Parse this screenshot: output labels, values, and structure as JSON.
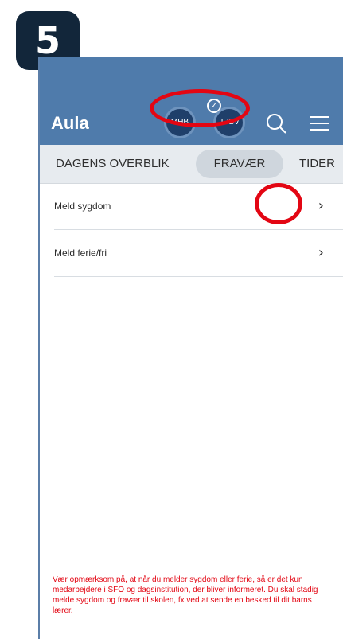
{
  "step": {
    "number": "5"
  },
  "header": {
    "title": "Aula",
    "avatars": [
      {
        "initials": "MHB"
      },
      {
        "initials": "JHBV"
      }
    ],
    "icons": [
      "checkmark-icon",
      "search-icon",
      "menu-icon"
    ]
  },
  "tabs": [
    {
      "label": "DAGENS OVERBLIK"
    },
    {
      "label": "FRAVÆR"
    },
    {
      "label": "TIDER"
    }
  ],
  "list": [
    {
      "label": "Meld sygdom",
      "chevron": "›"
    },
    {
      "label": "Meld ferie/fri",
      "chevron": "›"
    }
  ],
  "notice": {
    "text": "Vær opmærksom på, at når du melder sygdom eller ferie, så er det kun medarbejdere i SFO og dagsinstitution, der bliver informeret. Du skal stadig melde sygdom og fravær til skolen, fx ved at sende en besked til dit barns lærer."
  },
  "colors": {
    "header": "#4f7bab",
    "tabbar": "#e7ebef",
    "highlight": "#e30613",
    "badge": "#12263a",
    "notice_text": "#e30613"
  }
}
